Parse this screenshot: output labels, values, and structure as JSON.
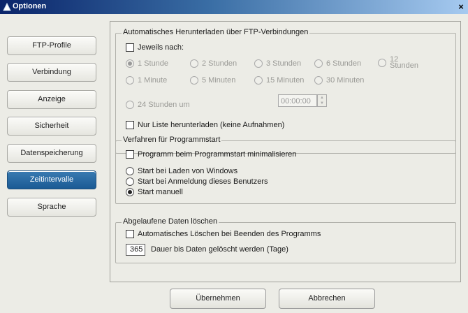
{
  "window": {
    "title": "Optionen",
    "close_glyph": "×"
  },
  "sidebar": {
    "items": [
      {
        "label": "FTP-Profile"
      },
      {
        "label": "Verbindung"
      },
      {
        "label": "Anzeige"
      },
      {
        "label": "Sicherheit"
      },
      {
        "label": "Datenspeicherung"
      },
      {
        "label": "Zeitintervalle",
        "active": true
      },
      {
        "label": "Sprache"
      }
    ]
  },
  "auto_download": {
    "legend": "Automatisches Herunterladen über FTP-Verbindungen",
    "every_label": "Jeweils nach:",
    "intervals": [
      "1 Stunde",
      "2 Stunden",
      "3 Stunden",
      "6 Stunden",
      "12 Stunden",
      "1 Minute",
      "5 Minuten",
      "15 Minuten",
      "30 Minuten"
    ],
    "daily_label": "24 Stunden um",
    "daily_time": "00:00:00",
    "list_only_label": "Nur Liste herunterladen (keine Aufnahmen)"
  },
  "startup": {
    "legend": "Verfahren für Programmstart",
    "minimize_label": "Programm beim Programmstart minimalisieren",
    "options": [
      "Start bei Laden von Windows",
      "Start bei Anmeldung dieses Benutzers",
      "Start manuell"
    ],
    "selected": "Start manuell"
  },
  "expiry": {
    "legend": "Abgelaufene Daten löschen",
    "auto_delete_label": "Automatisches Löschen bei Beenden des Programms",
    "days_value": "365",
    "days_label": "Dauer bis Daten gelöscht werden (Tage)"
  },
  "footer": {
    "apply_label": "Übernehmen",
    "cancel_label": "Abbrechen"
  },
  "colors": {
    "active_tab": "#1f5f99",
    "titlebar": "#0a246a"
  }
}
